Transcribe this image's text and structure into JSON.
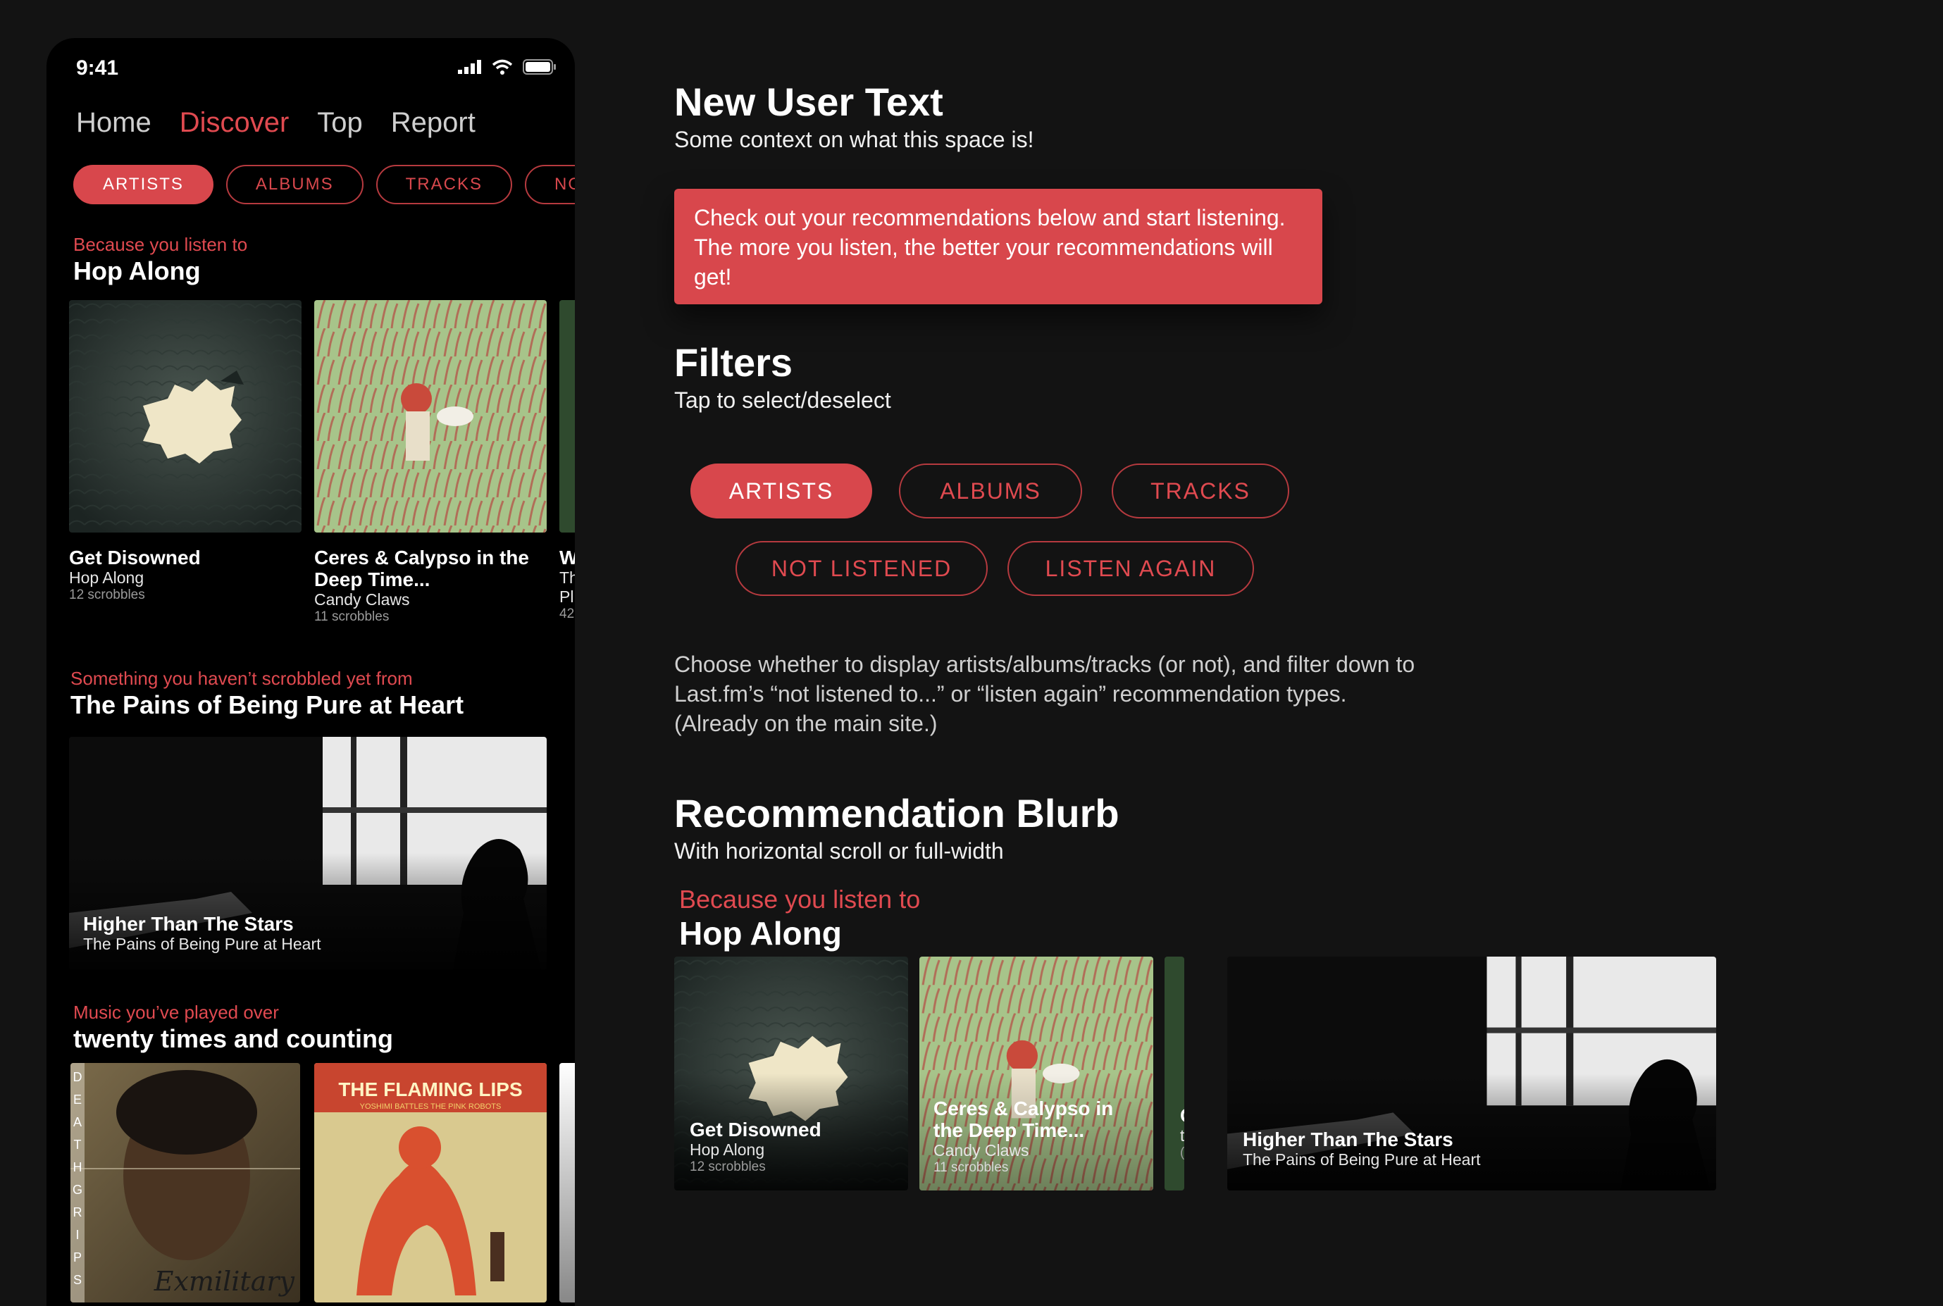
{
  "phone": {
    "status_time": "9:41",
    "nav": [
      "Home",
      "Discover",
      "Top",
      "Report"
    ],
    "chips": [
      "ARTISTS",
      "ALBUMS",
      "TRACKS",
      "NOT"
    ],
    "section1": {
      "kicker": "Because you listen to",
      "title": "Hop Along",
      "cards": [
        {
          "title": "Get Disowned",
          "artist": "Hop Along",
          "meta": "12 scrobbles"
        },
        {
          "title": "Ceres & Calypso in the Deep Time...",
          "artist": "Candy Claws",
          "meta": "11 scrobbles"
        },
        {
          "title": "W",
          "artist": "Th",
          "artist2": "Pl",
          "meta": "42"
        }
      ]
    },
    "section2": {
      "kicker": "Something you haven’t scrobbled yet from",
      "title": "The Pains of Being Pure at Heart",
      "card": {
        "title": "Higher Than The Stars",
        "artist": "The Pains of Being Pure at Heart"
      }
    },
    "section3": {
      "kicker": "Music you’ve played over",
      "title": "twenty times and counting",
      "album1_spine": [
        "D",
        "E",
        "A",
        "T",
        "H",
        "G",
        "R",
        "I",
        "P",
        "S"
      ],
      "album1_script": "Exmilitary",
      "album2_title": "THE FLAMING LIPS",
      "album2_sub": "YOSHIMI BATTLES THE PINK ROBOTS"
    }
  },
  "notes": {
    "new_user": {
      "title": "New User Text",
      "subtitle": "Some context on what this space is!"
    },
    "callout": "Check out your recommendations below and start listening. The more you listen, the better your recommendations will get!",
    "filters": {
      "title": "Filters",
      "subtitle": "Tap to select/deselect",
      "chips": [
        "ARTISTS",
        "ALBUMS",
        "TRACKS",
        "NOT LISTENED",
        "LISTEN AGAIN"
      ]
    },
    "filters_desc": "Choose whether to display artists/albums/tracks (or not), and filter down to Last.fm’s “not listened to...” or “listen again” recommendation types. (Already on the main site.)",
    "blurb": {
      "title": "Recommendation Blurb",
      "subtitle": "With horizontal scroll or full-width",
      "kicker": "Because you listen to",
      "heading": "Hop Along",
      "cards": [
        {
          "title": "Get Disowned",
          "artist": "Hop Along",
          "meta": "12 scrobbles"
        },
        {
          "title": "Ceres & Calypso in the Deep Time...",
          "artist": "Candy Claws",
          "meta": "11 scrobbles"
        },
        {
          "title": "C",
          "artist": "t",
          "meta": "("
        }
      ],
      "wide_card": {
        "title": "Higher Than The Stars",
        "artist": "The Pains of Being Pure at Heart"
      }
    }
  },
  "colors": {
    "accent": "#d8474c",
    "background": "#131313",
    "phone_bg": "#000000"
  }
}
